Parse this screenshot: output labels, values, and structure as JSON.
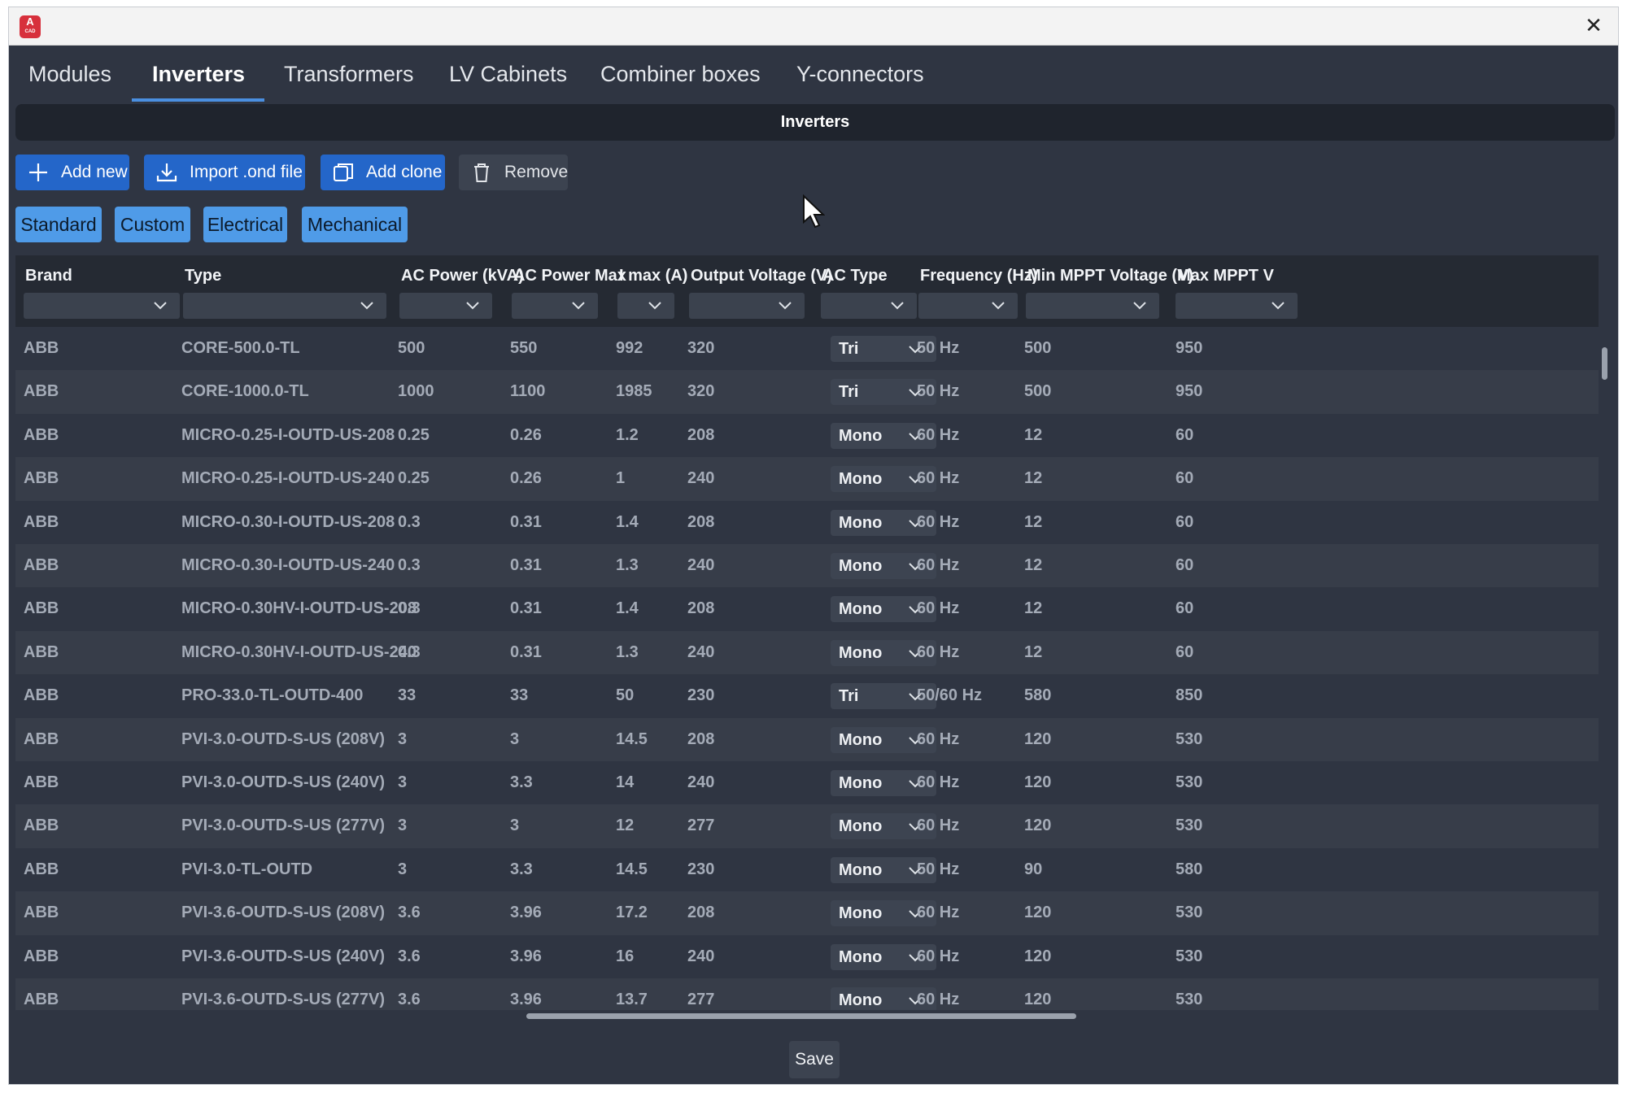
{
  "window": {
    "app_icon": {
      "letter": "A",
      "caption": "CAD",
      "color": "#d7303c"
    },
    "close_glyph": "✕"
  },
  "tabs": [
    {
      "label": "Modules",
      "active": false
    },
    {
      "label": "Inverters",
      "active": true
    },
    {
      "label": "Transformers",
      "active": false
    },
    {
      "label": "LV Cabinets",
      "active": false
    },
    {
      "label": "Combiner boxes",
      "active": false
    },
    {
      "label": "Y-connectors",
      "active": false
    }
  ],
  "section": {
    "title": "Inverters"
  },
  "toolbar": {
    "add_new": "Add new",
    "import": "Import .ond file",
    "add_clone": "Add clone",
    "remove": "Remove"
  },
  "filters": [
    "Standard",
    "Custom",
    "Electrical",
    "Mechanical"
  ],
  "table": {
    "columns": [
      "Brand",
      "Type",
      "AC Power (kVA)",
      "AC Power Max",
      "I max (A)",
      "Output Voltage (V)",
      "AC Type",
      "Frequency (Hz)",
      "Min MPPT Voltage (V)",
      "Max MPPT V"
    ],
    "rows": [
      [
        "ABB",
        "CORE-500.0-TL",
        "500",
        "550",
        "992",
        "320",
        "Tri",
        "50 Hz",
        "500",
        "950"
      ],
      [
        "ABB",
        "CORE-1000.0-TL",
        "1000",
        "1100",
        "1985",
        "320",
        "Tri",
        "50 Hz",
        "500",
        "950"
      ],
      [
        "ABB",
        "MICRO-0.25-I-OUTD-US-208",
        "0.25",
        "0.26",
        "1.2",
        "208",
        "Mono",
        "60 Hz",
        "12",
        "60"
      ],
      [
        "ABB",
        "MICRO-0.25-I-OUTD-US-240",
        "0.25",
        "0.26",
        "1",
        "240",
        "Mono",
        "60 Hz",
        "12",
        "60"
      ],
      [
        "ABB",
        "MICRO-0.30-I-OUTD-US-208",
        "0.3",
        "0.31",
        "1.4",
        "208",
        "Mono",
        "60 Hz",
        "12",
        "60"
      ],
      [
        "ABB",
        "MICRO-0.30-I-OUTD-US-240",
        "0.3",
        "0.31",
        "1.3",
        "240",
        "Mono",
        "60 Hz",
        "12",
        "60"
      ],
      [
        "ABB",
        "MICRO-0.30HV-I-OUTD-US-208",
        "0.3",
        "0.31",
        "1.4",
        "208",
        "Mono",
        "60 Hz",
        "12",
        "60"
      ],
      [
        "ABB",
        "MICRO-0.30HV-I-OUTD-US-240",
        "0.3",
        "0.31",
        "1.3",
        "240",
        "Mono",
        "60 Hz",
        "12",
        "60"
      ],
      [
        "ABB",
        "PRO-33.0-TL-OUTD-400",
        "33",
        "33",
        "50",
        "230",
        "Tri",
        "50/60 Hz",
        "580",
        "850"
      ],
      [
        "ABB",
        "PVI-3.0-OUTD-S-US (208V)",
        "3",
        "3",
        "14.5",
        "208",
        "Mono",
        "60 Hz",
        "120",
        "530"
      ],
      [
        "ABB",
        "PVI-3.0-OUTD-S-US (240V)",
        "3",
        "3.3",
        "14",
        "240",
        "Mono",
        "60 Hz",
        "120",
        "530"
      ],
      [
        "ABB",
        "PVI-3.0-OUTD-S-US (277V)",
        "3",
        "3",
        "12",
        "277",
        "Mono",
        "60 Hz",
        "120",
        "530"
      ],
      [
        "ABB",
        "PVI-3.0-TL-OUTD",
        "3",
        "3.3",
        "14.5",
        "230",
        "Mono",
        "50 Hz",
        "90",
        "580"
      ],
      [
        "ABB",
        "PVI-3.6-OUTD-S-US (208V)",
        "3.6",
        "3.96",
        "17.2",
        "208",
        "Mono",
        "60 Hz",
        "120",
        "530"
      ],
      [
        "ABB",
        "PVI-3.6-OUTD-S-US (240V)",
        "3.6",
        "3.96",
        "16",
        "240",
        "Mono",
        "60 Hz",
        "120",
        "530"
      ],
      [
        "ABB",
        "PVI-3.6-OUTD-S-US (277V)",
        "3.6",
        "3.96",
        "13.7",
        "277",
        "Mono",
        "60 Hz",
        "120",
        "530"
      ]
    ]
  },
  "footer": {
    "save": "Save"
  },
  "colors": {
    "accent": "#2466c9",
    "filter_chip": "#4f9be8",
    "background": "#2f3542",
    "row_alt": "#373d49"
  }
}
